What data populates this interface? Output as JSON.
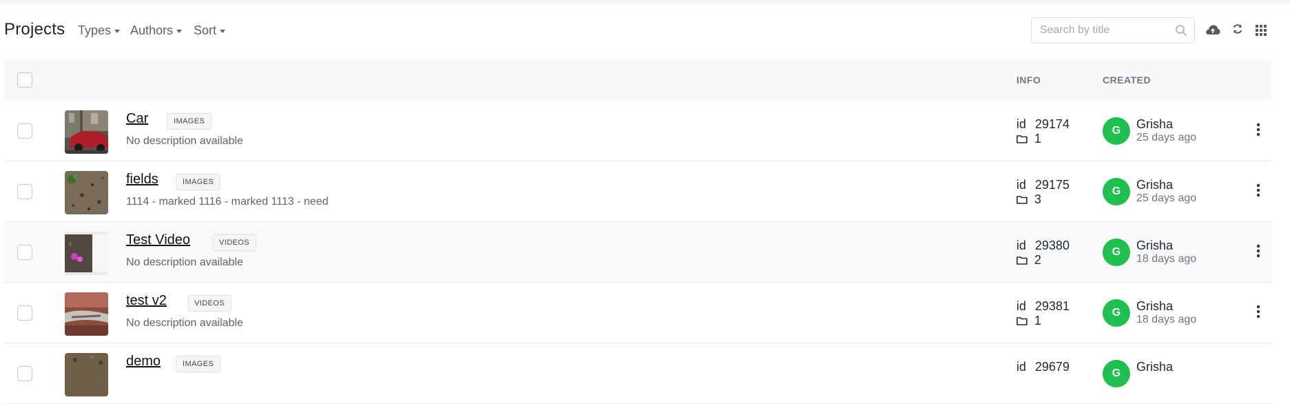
{
  "header": {
    "title": "Projects",
    "filters": [
      {
        "label": "Types"
      },
      {
        "label": "Authors"
      },
      {
        "label": "Sort"
      }
    ],
    "search": {
      "placeholder": "Search by title",
      "value": ""
    },
    "icons": [
      "search-icon",
      "cloud-upload-icon",
      "refresh-icon",
      "grid-icon"
    ]
  },
  "table": {
    "columns": {
      "info": "INFO",
      "created": "CREATED"
    },
    "rows": [
      {
        "title": "Car",
        "type": "IMAGES",
        "description": "No description available",
        "id_label": "id",
        "id": "29174",
        "count": "1",
        "author": "Grisha",
        "avatar_initial": "G",
        "created": "25 days ago"
      },
      {
        "title": "fields",
        "type": "IMAGES",
        "description": "1114 - marked 1116 - marked 1113 - need",
        "id_label": "id",
        "id": "29175",
        "count": "3",
        "author": "Grisha",
        "avatar_initial": "G",
        "created": "25 days ago"
      },
      {
        "title": "Test Video",
        "type": "VIDEOS",
        "description": "No description available",
        "id_label": "id",
        "id": "29380",
        "count": "2",
        "author": "Grisha",
        "avatar_initial": "G",
        "created": "18 days ago"
      },
      {
        "title": "test v2",
        "type": "VIDEOS",
        "description": "No description available",
        "id_label": "id",
        "id": "29381",
        "count": "1",
        "author": "Grisha",
        "avatar_initial": "G",
        "created": "18 days ago"
      },
      {
        "title": "demo",
        "type": "IMAGES",
        "description": "",
        "id_label": "id",
        "id": "29679",
        "count": "",
        "author": "Grisha",
        "avatar_initial": "G",
        "created": ""
      }
    ]
  },
  "colors": {
    "avatar": "#1fc04e",
    "header_bg": "#f6f8fa",
    "text_muted": "#6e7781"
  }
}
